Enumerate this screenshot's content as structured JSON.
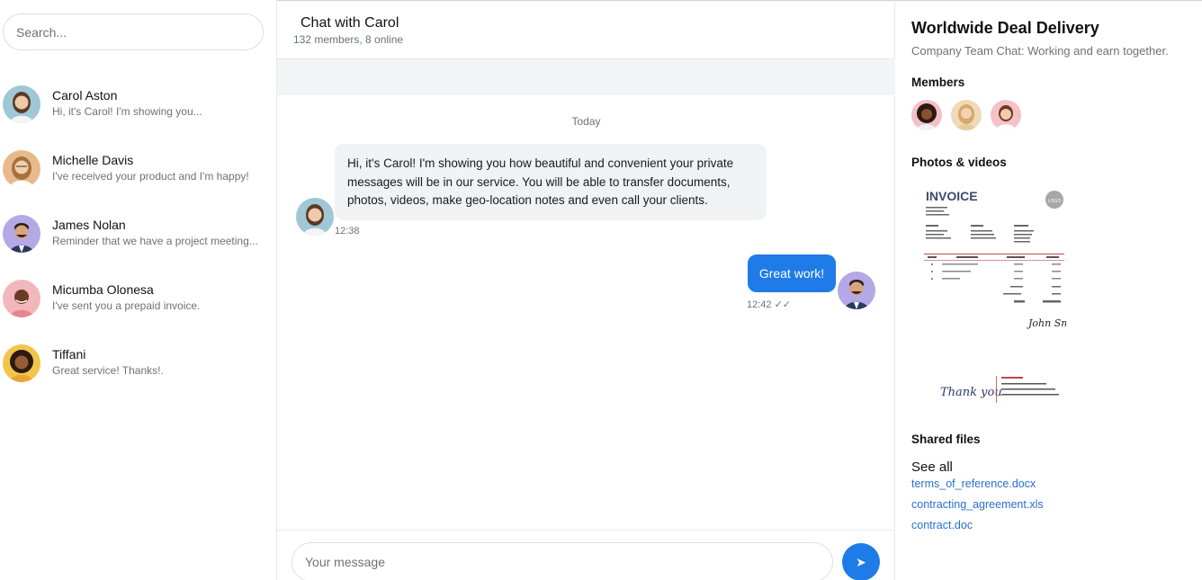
{
  "sidebar": {
    "search_placeholder": "Search...",
    "conversations": [
      {
        "name": "Carol Aston",
        "preview": "Hi, it's Carol! I'm showing you..."
      },
      {
        "name": "Michelle Davis",
        "preview": "I've received your product and I'm happy!"
      },
      {
        "name": "James Nolan",
        "preview": "Reminder that we have a project meeting..."
      },
      {
        "name": "Micumba Olonesa",
        "preview": "I've sent you a prepaid invoice."
      },
      {
        "name": "Tiffani",
        "preview": "Great service! Thanks!."
      }
    ]
  },
  "chat": {
    "title": "Chat with Carol",
    "subtitle": "132 members, 8 online",
    "date_divider": "Today",
    "messages": [
      {
        "direction": "in",
        "text": "Hi, it's Carol! I'm showing you how beautiful and convenient your private messages will be in our service. You will be able to transfer documents, photos, videos, make geo-location notes and even call your clients.",
        "time": "12:38"
      },
      {
        "direction": "out",
        "text": "Great work!",
        "time": "12:42 ✓✓"
      }
    ],
    "composer_placeholder": "Your message",
    "send_icon": "send-icon"
  },
  "info": {
    "title": "Worldwide Deal Delivery",
    "subtitle": "Company Team Chat: Working and earn together.",
    "members_heading": "Members",
    "photos_heading": "Photos & videos",
    "invoice_doc": {
      "heading": "INVOICE",
      "logo": "LOGO",
      "signature": "John Smith",
      "thanks": "Thank you"
    },
    "files_heading": "Shared files",
    "see_all": "See all",
    "files": [
      "terms_of_reference.docx",
      "contracting_agreement.xls",
      "contract.doc"
    ]
  },
  "colors": {
    "accent": "#1e7be8",
    "muted_text": "#6c7278",
    "incoming_bubble": "#f1f2f4",
    "link": "#2a6fcf"
  }
}
